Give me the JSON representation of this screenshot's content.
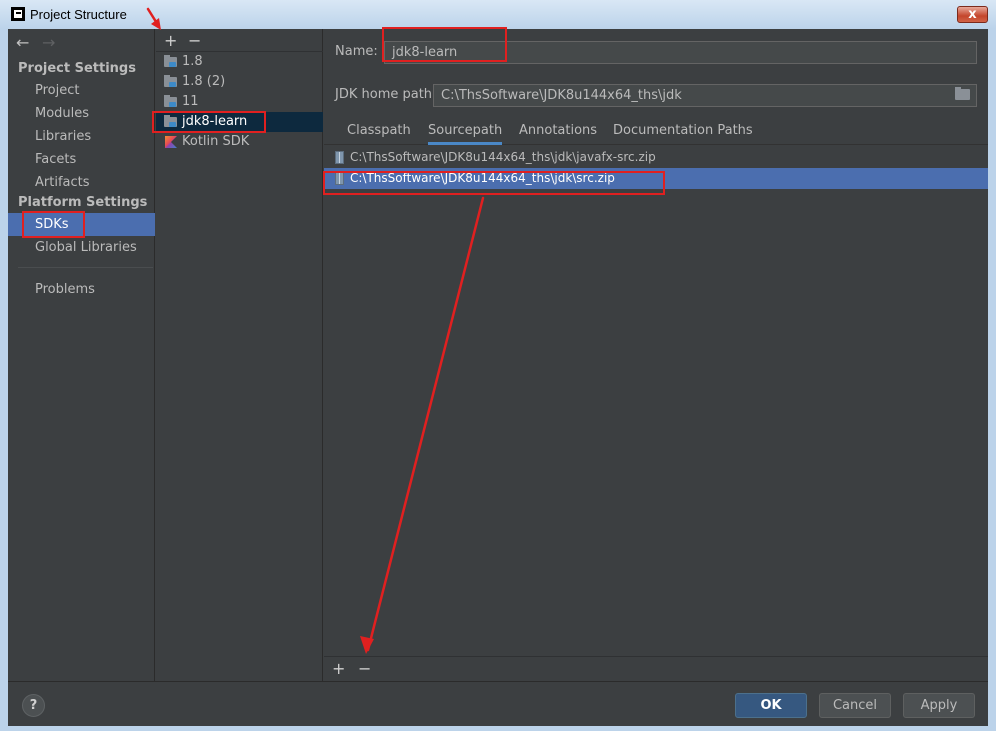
{
  "window": {
    "title": "Project Structure",
    "close_glyph": "x"
  },
  "nav": {
    "back_glyph": "←",
    "forward_glyph": "→",
    "groups": {
      "project_settings": "Project Settings",
      "platform_settings": "Platform Settings"
    },
    "items": {
      "project": "Project",
      "modules": "Modules",
      "libraries": "Libraries",
      "facets": "Facets",
      "artifacts": "Artifacts",
      "sdks": "SDKs",
      "global_libraries": "Global Libraries",
      "problems": "Problems"
    },
    "selected": "SDKs"
  },
  "sdk_list": {
    "add_glyph": "+",
    "remove_glyph": "−",
    "items": [
      "1.8",
      "1.8 (2)",
      "11",
      "jdk8-learn",
      "Kotlin SDK"
    ],
    "selected": "jdk8-learn"
  },
  "detail": {
    "name_label": "Name:",
    "name_value": "jdk8-learn",
    "home_label": "JDK home path:",
    "home_value": "C:\\ThsSoftware\\JDK8u144x64_ths\\jdk",
    "tabs": [
      "Classpath",
      "Sourcepath",
      "Annotations",
      "Documentation Paths"
    ],
    "active_tab": "Sourcepath",
    "paths": [
      "C:\\ThsSoftware\\JDK8u144x64_ths\\jdk\\javafx-src.zip",
      "C:\\ThsSoftware\\JDK8u144x64_ths\\jdk\\src.zip"
    ],
    "selected_path_index": 1,
    "add_glyph": "+",
    "remove_glyph": "−"
  },
  "footer": {
    "help_glyph": "?",
    "ok": "OK",
    "cancel": "Cancel",
    "apply": "Apply"
  },
  "colors": {
    "annotation": "#e02020",
    "selection": "#4b6eaf",
    "background": "#3c3f41"
  }
}
